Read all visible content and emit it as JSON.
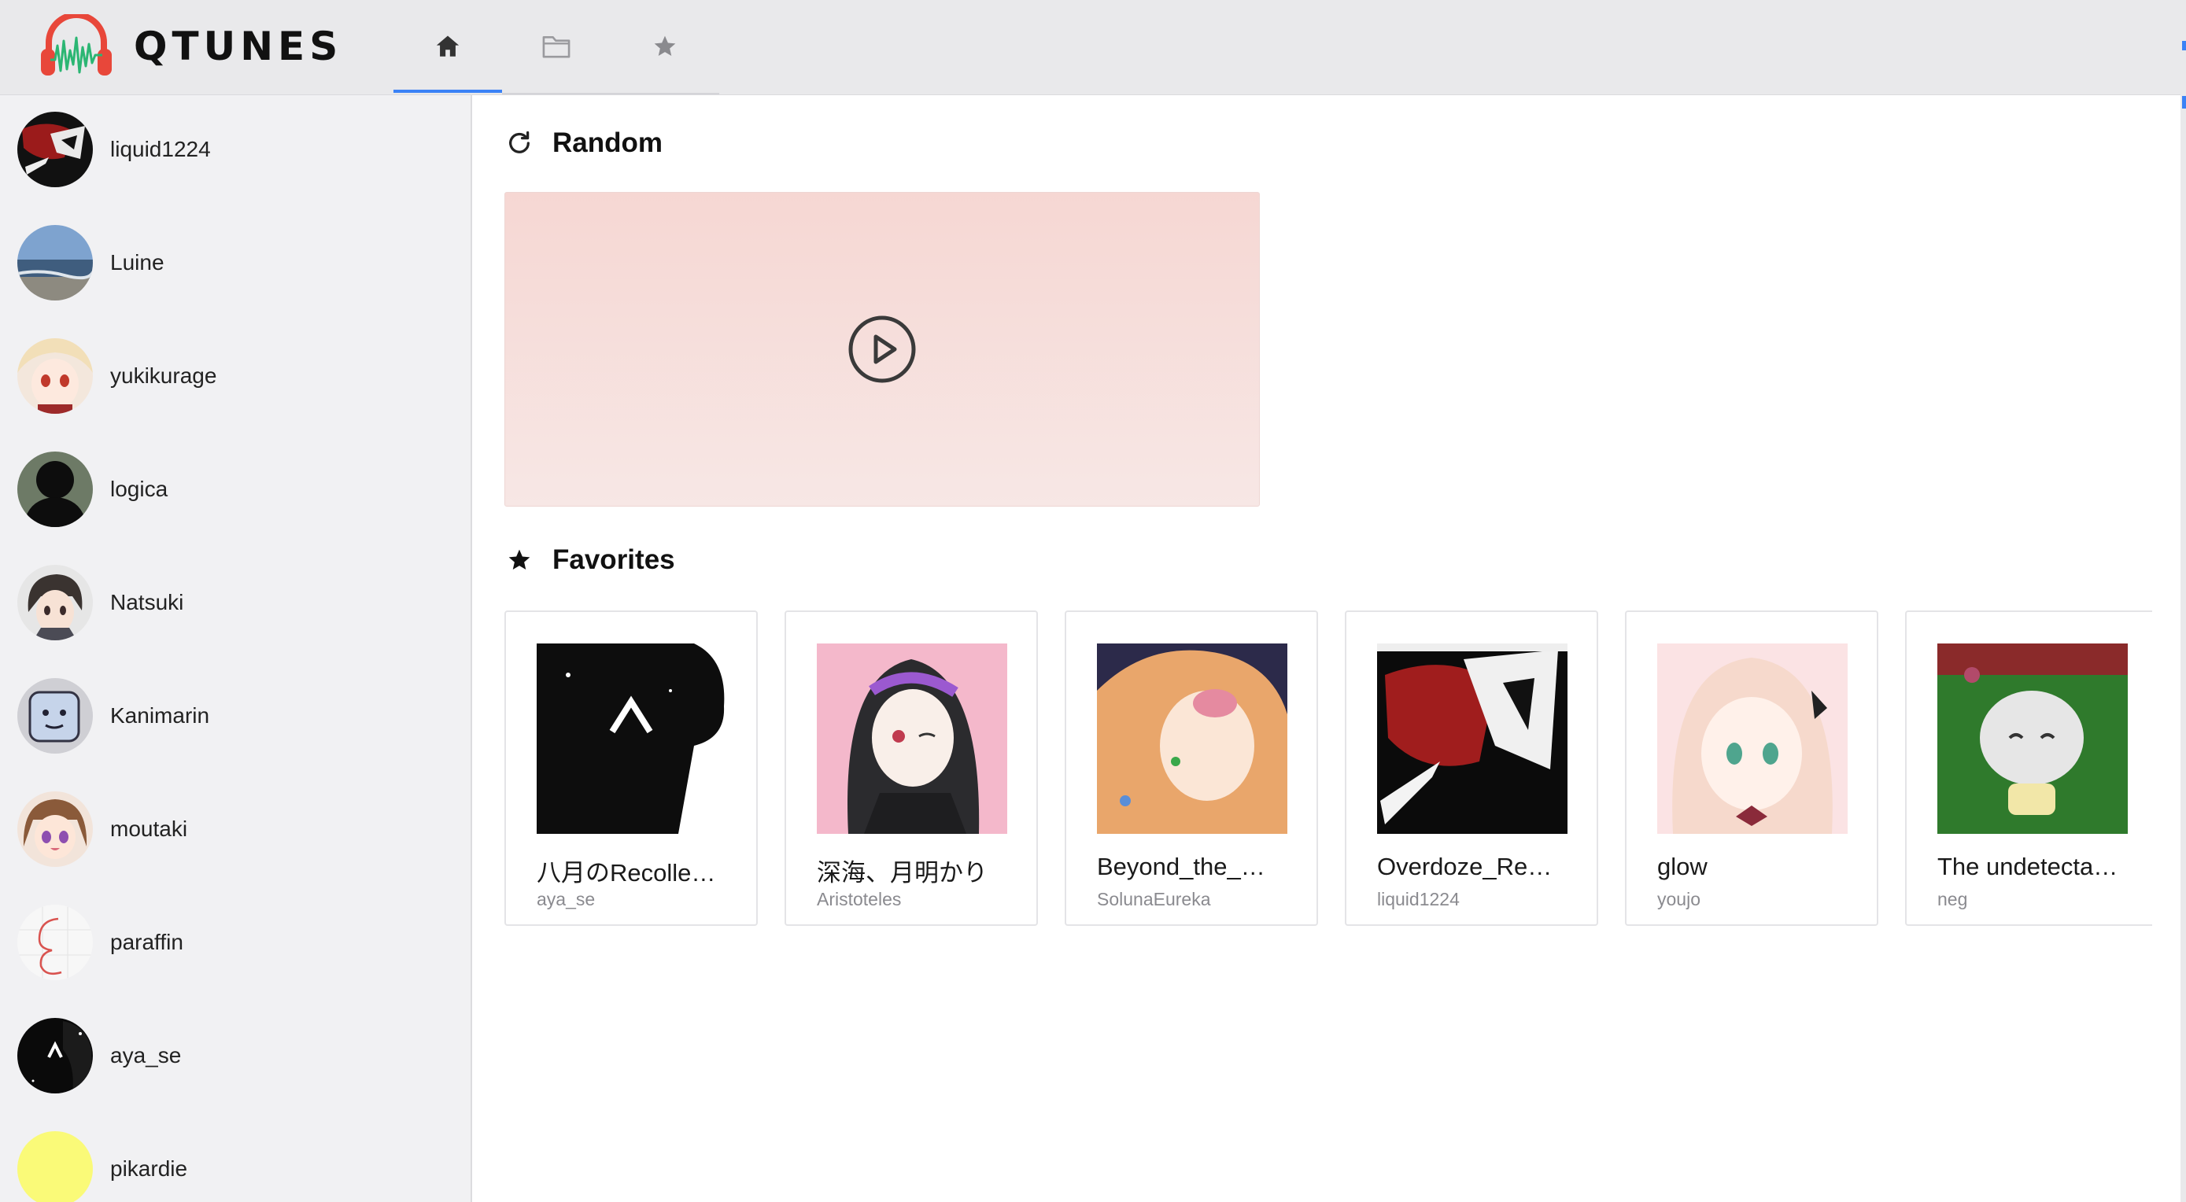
{
  "app": {
    "name": "QTUNES",
    "logo": "headphones-waveform-logo",
    "brand_color": "#e8473a"
  },
  "nav": {
    "tabs": [
      {
        "id": "home",
        "icon": "home-icon",
        "active": true
      },
      {
        "id": "library",
        "icon": "folder-icon",
        "active": false
      },
      {
        "id": "favorites",
        "icon": "star-icon",
        "active": false
      }
    ],
    "active_color": "#3b82f6"
  },
  "sidebar": {
    "artists": [
      {
        "name": "liquid1224"
      },
      {
        "name": "Luine"
      },
      {
        "name": "yukikurage"
      },
      {
        "name": "logica"
      },
      {
        "name": "Natsuki"
      },
      {
        "name": "Kanimarin"
      },
      {
        "name": "moutaki"
      },
      {
        "name": "paraffin"
      },
      {
        "name": "aya_se"
      },
      {
        "name": "pikardie"
      }
    ]
  },
  "random": {
    "title": "Random",
    "icon": "refresh-icon",
    "play_icon": "play-circle-icon"
  },
  "favorites": {
    "title": "Favorites",
    "icon": "star-icon",
    "items": [
      {
        "title": "八月のRecolle…",
        "artist": "aya_se"
      },
      {
        "title": "深海、月明かり",
        "artist": "Aristoteles"
      },
      {
        "title": "Beyond_the_…",
        "artist": "SolunaEureka"
      },
      {
        "title": "Overdoze_Re…",
        "artist": "liquid1224"
      },
      {
        "title": "glow",
        "artist": "youjo"
      },
      {
        "title": "The undetecta…",
        "artist": "neg"
      }
    ]
  }
}
